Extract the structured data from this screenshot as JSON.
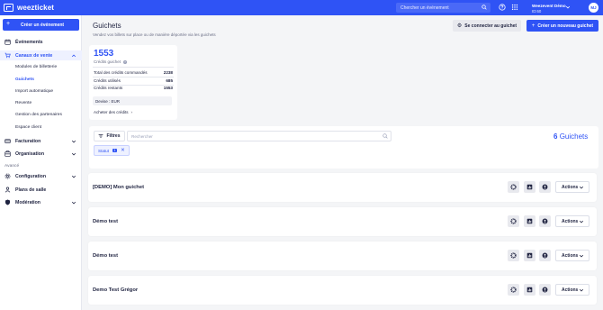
{
  "app": {
    "name": "weezticket"
  },
  "topbar": {
    "search_placeholder": "Chercher un événement",
    "account_name": "Weezevent Démo",
    "account_id": "ID:60",
    "avatar_initials": "MJ"
  },
  "sidebar": {
    "create_label": "Créer un événement",
    "items": {
      "events": "Événements",
      "sales": "Canaux de vente",
      "billing": "Facturation",
      "organisation": "Organisation",
      "config": "Configuration",
      "plans": "Plans de salle",
      "moderation": "Modération"
    },
    "sub_items": [
      "Modules de billetterie",
      "Guichets",
      "Import automatique",
      "Revente",
      "Gestion des partenaires",
      "Espace client"
    ],
    "section_advanced": "Avancé"
  },
  "page": {
    "title": "Guichets",
    "subtitle": "Vendez vos billets sur place ou de manière déportée via les guichets",
    "connect_label": "Se connecter au guichet",
    "new_label": "Créer un nouveau guichet"
  },
  "credits": {
    "value": "1553",
    "label": "Crédits guichet",
    "info": "?",
    "rows": [
      {
        "label": "Total des crédits commandés",
        "value": "2238"
      },
      {
        "label": "Crédits utilisés",
        "value": "685"
      },
      {
        "label": "Crédits restants",
        "value": "1553"
      }
    ],
    "currency": "Devise : EUR",
    "buy_label": "Acheter des crédits"
  },
  "filters": {
    "button_label": "Filtres",
    "search_placeholder": "Rechercher",
    "count_number": "6",
    "count_label": "Guichets",
    "chip_label": "Statut",
    "chip_count": "1"
  },
  "guichets": [
    {
      "name": "[DEMO] Mon guichet"
    },
    {
      "name": "Démo test"
    },
    {
      "name": "Démo test"
    },
    {
      "name": "Demo Test Grégor"
    }
  ],
  "row_actions_label": "Actions",
  "colors": {
    "primary": "#2f53f5",
    "background": "#f4f5f7"
  }
}
